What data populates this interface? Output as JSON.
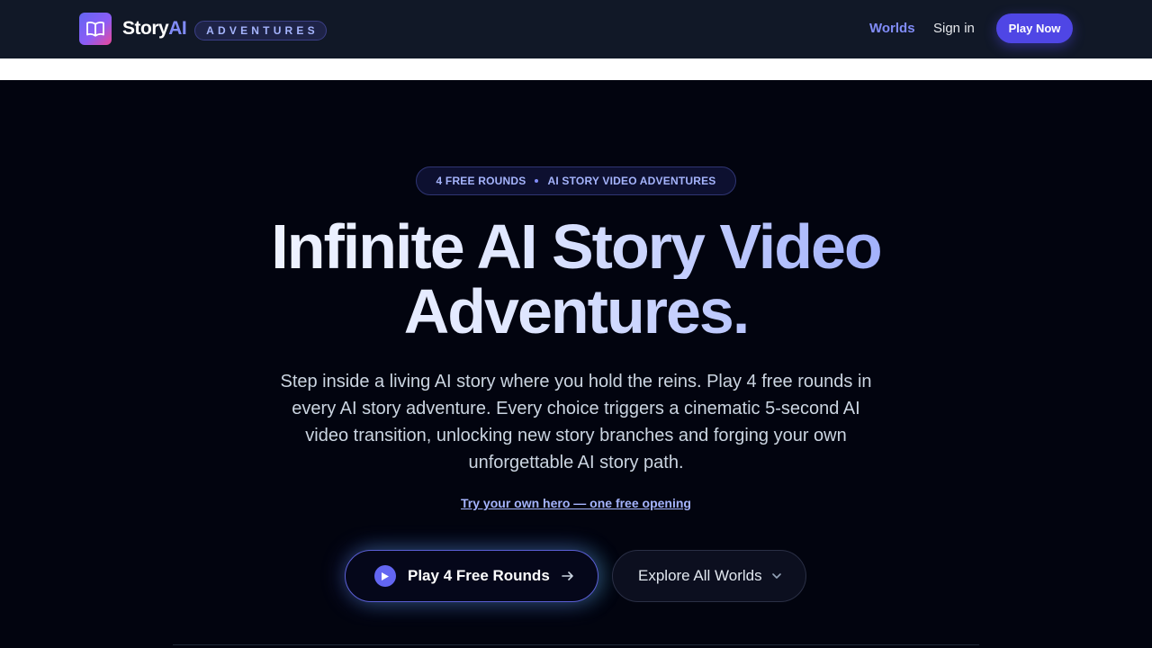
{
  "nav": {
    "brand_part1": "Story",
    "brand_part2": "AI",
    "brand_tag": "ADVENTURES",
    "worlds_label": "Worlds",
    "signin_label": "Sign in",
    "play_now_label": "Play Now",
    "logo_icon": "book-open-icon"
  },
  "hero": {
    "badge_left": "4 FREE ROUNDS",
    "badge_right": "AI STORY VIDEO ADVENTURES",
    "headline_line1": "Infinite AI Story Video",
    "headline_line2": "Adventures.",
    "description": "Step inside a living AI story where you hold the reins. Play 4 free rounds in every AI story adventure. Every choice triggers a cinematic 5-second AI video transition, unlocking new story branches and forging your own unforgettable AI story path.",
    "try_link": "Try your own hero — one free opening",
    "cta_primary": "Play 4 Free Rounds",
    "cta_secondary": "Explore All Worlds"
  },
  "colors": {
    "accent": "#4f46e5",
    "accent_light": "#818cf8",
    "nav_bg": "#111827",
    "page_bg": "#02040f"
  }
}
